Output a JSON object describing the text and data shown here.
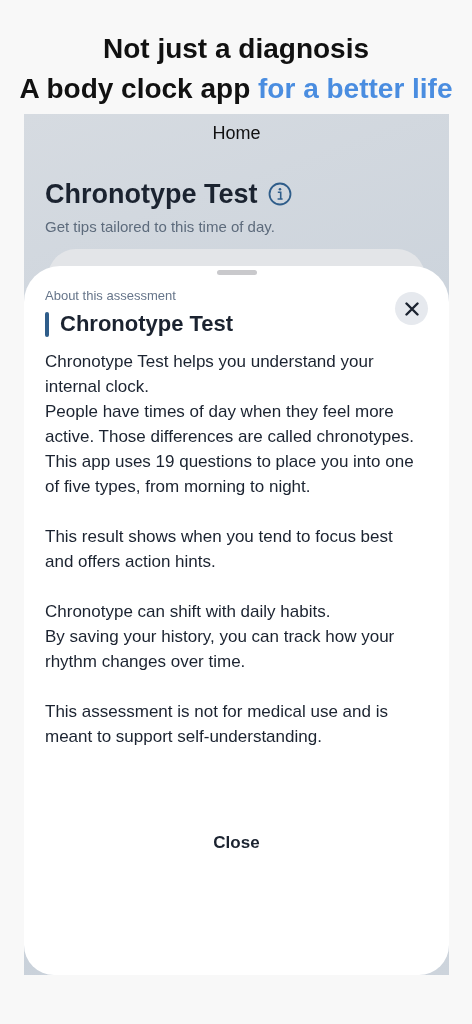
{
  "headline": [
    {
      "segments": [
        {
          "text": "Not just a diagnosis",
          "highlight": false
        }
      ]
    },
    {
      "segments": [
        {
          "text": "A body clock app ",
          "highlight": false
        },
        {
          "text": "for a better life",
          "highlight": true
        }
      ]
    }
  ],
  "screen": {
    "nav_title": "Home",
    "page_title": "Chronotype Test",
    "page_subtitle": "Get tips tailored to this time of day.",
    "sheet": {
      "eyebrow": "About this assessment",
      "title": "Chronotype Test",
      "paragraphs": [
        [
          "Chronotype Test helps you understand your internal clock.",
          "People have times of day when they feel more active. Those differences are called chronotypes.",
          "This app uses 19 questions to place you into one of five types, from morning to night."
        ],
        [
          "This result shows when you tend to focus best and offers action hints."
        ],
        [
          "Chronotype can shift with daily habits.",
          "By saving your history, you can track how your rhythm changes over time."
        ],
        [
          "This assessment is not for medical use and is meant to support self-understanding."
        ]
      ],
      "close_label": "Close"
    }
  }
}
